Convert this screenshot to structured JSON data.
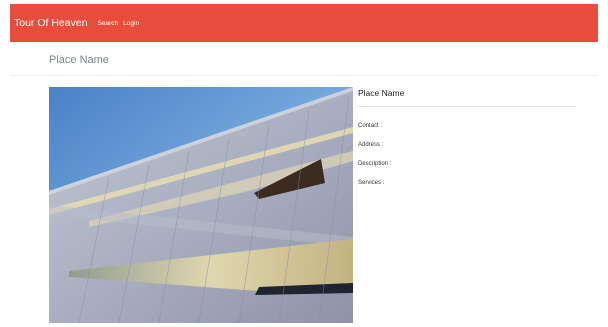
{
  "navbar": {
    "brand": "Tour Of Heaven",
    "links": [
      "Search",
      "Login"
    ],
    "bg_color": "#e74c3c"
  },
  "page": {
    "title": "Place Name"
  },
  "place": {
    "name": "Place Name",
    "fields": [
      "Contact :",
      "Address :",
      "Description :",
      "Services :"
    ]
  }
}
